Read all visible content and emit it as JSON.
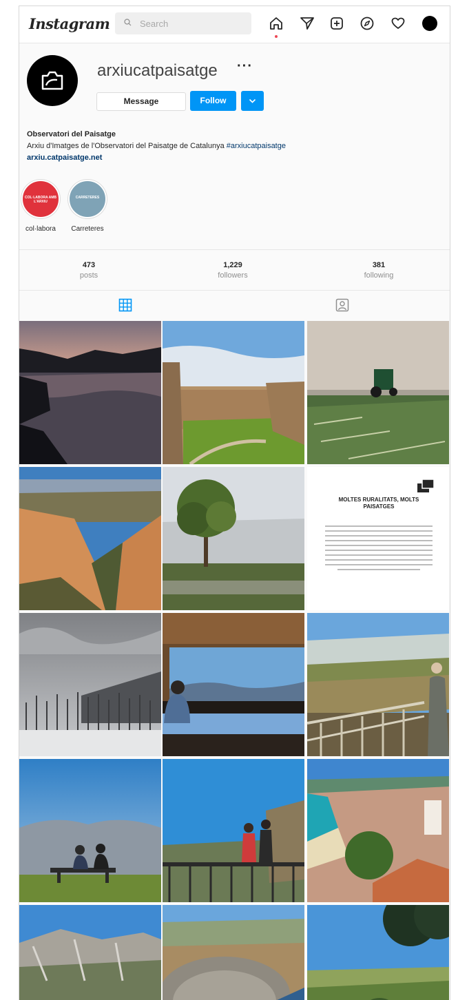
{
  "app": {
    "logo": "Instagram"
  },
  "search": {
    "placeholder": "Search"
  },
  "nav": {
    "icons": [
      "home-icon",
      "direct-icon",
      "new-post-icon",
      "explore-icon",
      "activity-heart-icon",
      "profile-avatar"
    ]
  },
  "profile": {
    "username": "arxiucatpaisatge",
    "more_label": "···",
    "message_label": "Message",
    "follow_label": "Follow",
    "bio": {
      "name": "Observatori del Paisatge",
      "line": "Arxiu d'Imatges de l'Observatori del Paisatge de Catalunya",
      "hashtag": "#arxiucatpaisatge",
      "link": "arxiu.catpaisatge.net"
    }
  },
  "highlights": [
    {
      "label": "col·labora",
      "inner": "COL·LABORA AMB L'ARXIU",
      "color": "#e0323c"
    },
    {
      "label": "Carreteres",
      "inner": "CARRETERES",
      "color": "#7fa3b6"
    }
  ],
  "stats": {
    "posts": {
      "value": "473",
      "label": "posts"
    },
    "followers": {
      "value": "1,229",
      "label": "followers"
    },
    "following": {
      "value": "381",
      "label": "following"
    }
  },
  "tabs": [
    "grid-icon",
    "tagged-icon"
  ],
  "posts": [
    {
      "name": "post-lake-dusk"
    },
    {
      "name": "post-fortress"
    },
    {
      "name": "post-tractor-field"
    },
    {
      "name": "post-canyon"
    },
    {
      "name": "post-tree-wall"
    },
    {
      "name": "post-text-card",
      "title": "MOLTES RURALITATS, MOLTS PAISATGES"
    },
    {
      "name": "post-winter-forest"
    },
    {
      "name": "post-window-view"
    },
    {
      "name": "post-viewpoint-man"
    },
    {
      "name": "post-bench-couple"
    },
    {
      "name": "post-couple-railing"
    },
    {
      "name": "post-coastal-town"
    },
    {
      "name": "post-mountain-ridge"
    },
    {
      "name": "post-stone-terrace"
    },
    {
      "name": "post-pine-valley"
    }
  ]
}
